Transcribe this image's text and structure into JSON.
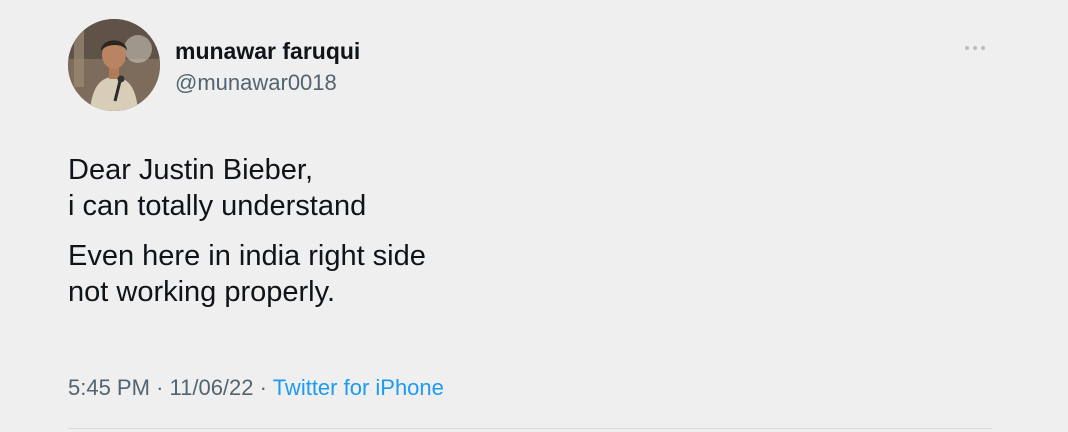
{
  "author": {
    "name": "munawar faruqui",
    "handle": "@munawar0018"
  },
  "tweet": {
    "paragraphs": [
      [
        "Dear Justin Bieber,",
        "i can totally understand"
      ],
      [
        "Even here in india right side",
        "not working properly."
      ]
    ],
    "time": "5:45 PM",
    "date": "11/06/22",
    "separator": "·",
    "source": "Twitter for iPhone"
  },
  "icons": {
    "avatar": "profile-photo",
    "more": "more-horizontal-icon"
  },
  "colors": {
    "background": "#efeff0",
    "text": "#0f1419",
    "secondary": "#536471",
    "link": "#1d9bf0"
  }
}
